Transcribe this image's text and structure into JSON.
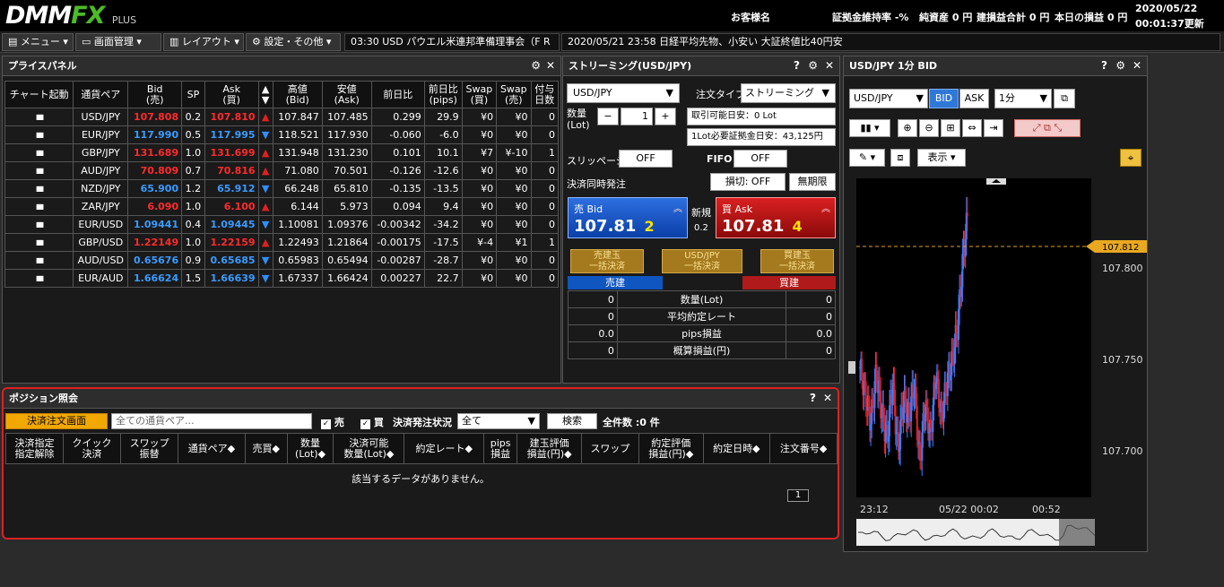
{
  "app": {
    "logo_main": "DMM",
    "logo_fx": "FX",
    "logo_plus": "PLUS",
    "customer": "お客様名"
  },
  "stats": {
    "margin_ratio_label": "証拠金維持率",
    "margin_ratio": "-%",
    "net_assets_label": "純資産",
    "net_assets": "0 円",
    "total_pl_label": "建損益合計",
    "total_pl": "0 円",
    "today_pl_label": "本日の損益",
    "today_pl": "0 円",
    "date": "2020/05/22",
    "time": "00:01:37更新"
  },
  "menu": {
    "menu": "メニュー",
    "screen": "画面管理",
    "layout": "レイアウト",
    "settings": "設定・その他"
  },
  "news": [
    {
      "text": "03:30  USD パウエル米連邦準備理事会（F R"
    },
    {
      "text": "2020/05/21 23:58  日経平均先物、小安い  大証終値比40円安"
    }
  ],
  "price_panel": {
    "title": "プライスパネル",
    "headers": [
      "チャート起動",
      "通貨ペア",
      "Bid\n(売)",
      "SP",
      "Ask\n(買)",
      "▲\n▼",
      "高値\n(Bid)",
      "安値\n(Ask)",
      "前日比",
      "前日比\n(pips)",
      "Swap\n(買)",
      "Swap\n(売)",
      "付与\n日数"
    ],
    "rows": [
      {
        "pair": "USD/JPY",
        "bid": "107.808",
        "sp": "0.2",
        "ask": "107.810",
        "dir": "up",
        "high": "107.847",
        "low": "107.485",
        "chg": "0.299",
        "pips": "29.9",
        "swb": "¥0",
        "sws": "¥0",
        "days": "0"
      },
      {
        "pair": "EUR/JPY",
        "bid": "117.990",
        "sp": "0.5",
        "ask": "117.995",
        "dir": "down",
        "high": "118.521",
        "low": "117.930",
        "chg": "-0.060",
        "pips": "-6.0",
        "swb": "¥0",
        "sws": "¥0",
        "days": "0"
      },
      {
        "pair": "GBP/JPY",
        "bid": "131.689",
        "sp": "1.0",
        "ask": "131.699",
        "dir": "up",
        "high": "131.948",
        "low": "131.230",
        "chg": "0.101",
        "pips": "10.1",
        "swb": "¥7",
        "sws": "¥-10",
        "days": "1"
      },
      {
        "pair": "AUD/JPY",
        "bid": "70.809",
        "sp": "0.7",
        "ask": "70.816",
        "dir": "up",
        "high": "71.080",
        "low": "70.501",
        "chg": "-0.126",
        "pips": "-12.6",
        "swb": "¥0",
        "sws": "¥0",
        "days": "0"
      },
      {
        "pair": "NZD/JPY",
        "bid": "65.900",
        "sp": "1.2",
        "ask": "65.912",
        "dir": "down",
        "high": "66.248",
        "low": "65.810",
        "chg": "-0.135",
        "pips": "-13.5",
        "swb": "¥0",
        "sws": "¥0",
        "days": "0"
      },
      {
        "pair": "ZAR/JPY",
        "bid": "6.090",
        "sp": "1.0",
        "ask": "6.100",
        "dir": "up",
        "high": "6.144",
        "low": "5.973",
        "chg": "0.094",
        "pips": "9.4",
        "swb": "¥0",
        "sws": "¥0",
        "days": "0"
      },
      {
        "pair": "EUR/USD",
        "bid": "1.09441",
        "sp": "0.4",
        "ask": "1.09445",
        "dir": "down",
        "high": "1.10081",
        "low": "1.09376",
        "chg": "-0.00342",
        "pips": "-34.2",
        "swb": "¥0",
        "sws": "¥0",
        "days": "0"
      },
      {
        "pair": "GBP/USD",
        "bid": "1.22149",
        "sp": "1.0",
        "ask": "1.22159",
        "dir": "up",
        "high": "1.22493",
        "low": "1.21864",
        "chg": "-0.00175",
        "pips": "-17.5",
        "swb": "¥-4",
        "sws": "¥1",
        "days": "1"
      },
      {
        "pair": "AUD/USD",
        "bid": "0.65676",
        "sp": "0.9",
        "ask": "0.65685",
        "dir": "down",
        "high": "0.65983",
        "low": "0.65494",
        "chg": "-0.00287",
        "pips": "-28.7",
        "swb": "¥0",
        "sws": "¥0",
        "days": "0"
      },
      {
        "pair": "EUR/AUD",
        "bid": "1.66624",
        "sp": "1.5",
        "ask": "1.66639",
        "dir": "down",
        "high": "1.67337",
        "low": "1.66424",
        "chg": "0.00227",
        "pips": "22.7",
        "swb": "¥0",
        "sws": "¥0",
        "days": "0"
      }
    ]
  },
  "streaming": {
    "title": "ストリーミング(USD/JPY)",
    "pair": "USD/JPY",
    "order_type_label": "注文タイプ",
    "order_type": "ストリーミング",
    "qty_label": "数量\n(Lot)",
    "qty": "1",
    "minus": "−",
    "plus": "+",
    "tradable": "取引可能日安：0 Lot",
    "margin_req": "1Lot必要証拠金日安：43,125円",
    "slippage_label": "スリッページ",
    "slippage": "OFF",
    "fifo_label": "FIFO",
    "fifo": "OFF",
    "settle_label": "決済同時発注",
    "stoploss": "損切: OFF",
    "unlimited": "無期限",
    "sell_label": "売 Bid",
    "sell_main": "107.81",
    "sell_small": "2",
    "new_label": "新規",
    "spread": "0.2",
    "buy_label": "買 Ask",
    "buy_main": "107.81",
    "buy_small": "4",
    "btn_sell_close": "売建玉\n一括決済",
    "btn_all_close": "USD/JPY\n一括決済",
    "btn_buy_close": "買建玉\n一括決済",
    "sell_hdr": "売建",
    "buy_hdr": "買建",
    "summary": [
      {
        "label": "数量(Lot)",
        "sell": "0",
        "buy": "0"
      },
      {
        "label": "平均約定レート",
        "sell": "0",
        "buy": "0"
      },
      {
        "label": "pips損益",
        "sell": "0.0",
        "buy": "0.0"
      },
      {
        "label": "概算損益(円)",
        "sell": "0",
        "buy": "0"
      }
    ]
  },
  "chart": {
    "title": "USD/JPY 1分 BID",
    "pair": "USD/JPY",
    "bid": "BID",
    "ask": "ASK",
    "interval": "1分",
    "display": "表示",
    "current": "107.812",
    "y_ticks": [
      "107.800",
      "107.750",
      "107.700"
    ],
    "x_ticks": [
      "23:12",
      "05/22 00:02",
      "00:52"
    ],
    "chart_data": {
      "type": "candlestick",
      "ylim": [
        107.685,
        107.825
      ],
      "current_price": 107.812,
      "y_ticks": [
        107.8,
        107.75,
        107.7
      ],
      "x_ticks": [
        "23:12",
        "05/22 00:02",
        "00:52"
      ]
    }
  },
  "positions": {
    "title": "ポジション照会",
    "settle_btn": "決済注文画面",
    "pair_placeholder": "全ての通貨ペア...",
    "sell_chk": "売",
    "buy_chk": "買",
    "status_label": "決済発注状況",
    "status": "全て",
    "search": "検索",
    "count": "全件数 :0 件",
    "headers": [
      "決済指定\n指定解除",
      "クイック\n決済",
      "スワップ\n振替",
      "通貨ペア◆",
      "売買◆",
      "数量\n(Lot)◆",
      "決済可能\n数量(Lot)◆",
      "約定レート◆",
      "pips\n損益",
      "建玉評価\n損益(円)◆",
      "スワップ",
      "約定評価\n損益(円)◆",
      "約定日時◆",
      "注文番号◆"
    ],
    "empty": "該当するデータがありません。",
    "page": "1"
  }
}
